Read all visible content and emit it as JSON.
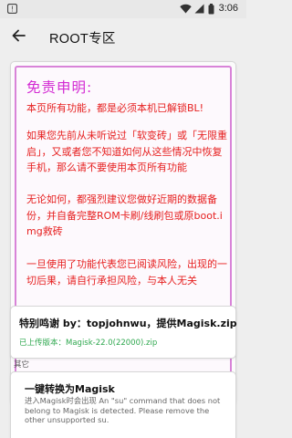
{
  "status_bar": {
    "time": "3:06",
    "icons": [
      "notification-icon",
      "wifi-icon",
      "cellular-signal-icon",
      "battery-icon"
    ]
  },
  "app_bar": {
    "back_icon": "back-arrow-icon",
    "title": "ROOT专区"
  },
  "disclaimer": {
    "title": "免责申明:",
    "paragraphs": [
      "本页所有功能，都是必须本机已解锁BL!",
      "如果您先前从未听说过「软变砖」或「无限重启」，又或者您不知道如何从这些情况中恢复手机，那么请不要使用本页所有功能",
      "无论如何，都强烈建议您做好近期的数据备份，并自备完整ROM卡刷/线刷包或原boot.img救砖",
      "一旦使用了功能代表您已阅读风险，出现的一切后果，请自行承担风险，与本人无关"
    ],
    "colors": {
      "title": "#d32bd3",
      "body": "#e62020",
      "border": "#d884d8"
    }
  },
  "credits": {
    "text": "特别鸣谢 by：topjohnwu，提供Magisk.zip",
    "uploaded": "已上传版本：Magisk-22.0(22000).zip",
    "accent": "#2fa84f"
  },
  "other_section": {
    "label": "其它",
    "items": [
      {
        "title": "一键转换为Magisk",
        "description": "进入Magisk时会出现 An \"su\" command that does not belong to Magisk is detected. Please remove the other unsupported su."
      }
    ]
  }
}
